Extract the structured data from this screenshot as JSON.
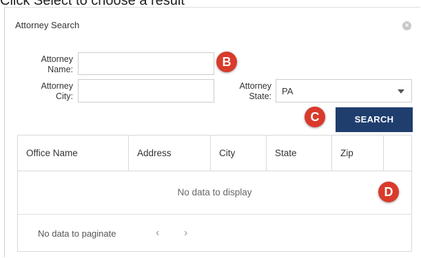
{
  "caption": "Click Select to choose a result",
  "dialog": {
    "title": "Attorney Search",
    "close_glyph": "×"
  },
  "form": {
    "name_label_line1": "Attorney",
    "name_label_line2": "Name:",
    "name_value": "",
    "city_label_line1": "Attorney",
    "city_label_line2": "City:",
    "city_value": "",
    "state_label_line1": "Attorney",
    "state_label_line2": "State:",
    "state_value": "PA",
    "search_label": "SEARCH"
  },
  "markers": {
    "b": "B",
    "c": "C",
    "d": "D",
    "color": "#d93a2b"
  },
  "grid": {
    "columns": [
      "Office Name",
      "Address",
      "City",
      "State",
      "Zip"
    ],
    "empty_text": "No data to display",
    "pager_text": "No data to paginate",
    "prev_glyph": "‹",
    "next_glyph": "›"
  },
  "colors": {
    "search_button": "#1f3e6e",
    "border": "#d8d8d8"
  }
}
